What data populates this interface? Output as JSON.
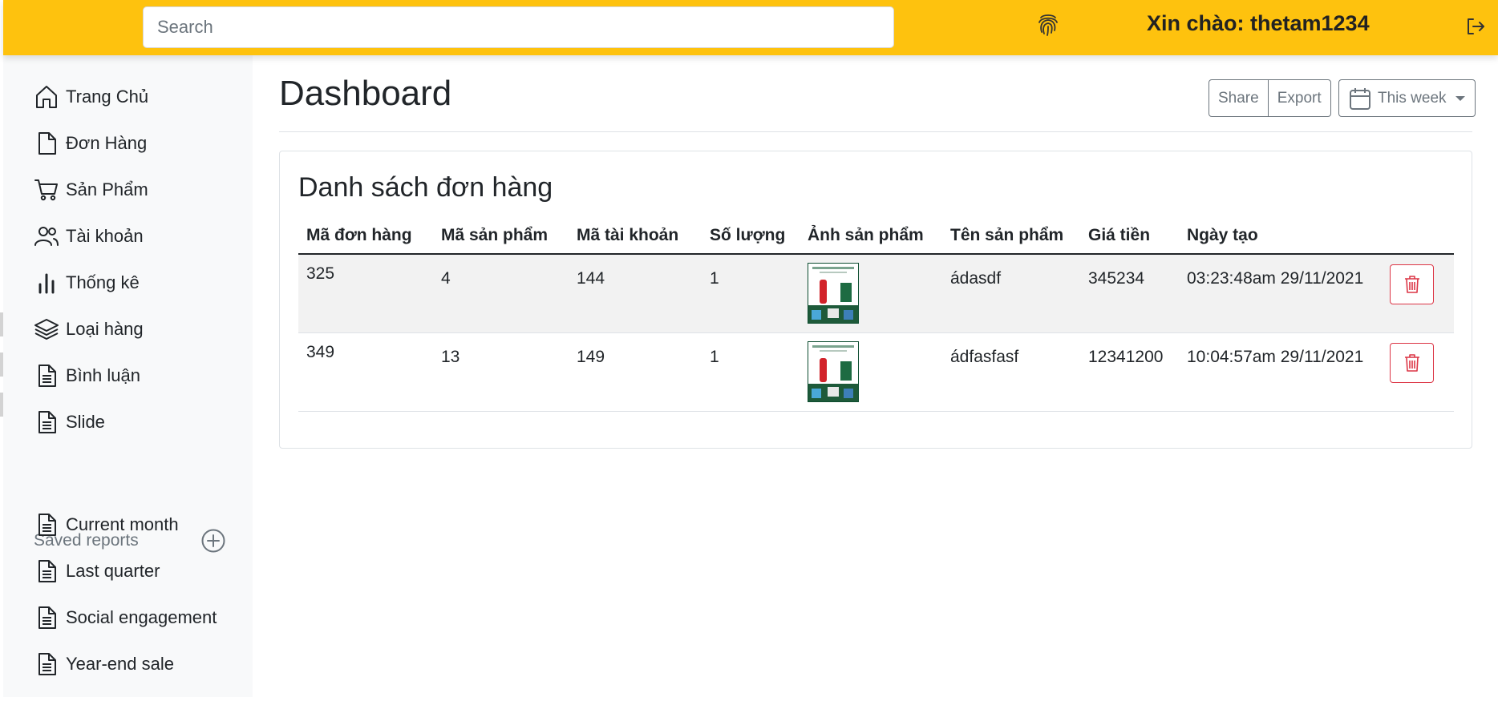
{
  "search": {
    "placeholder": "Search",
    "value": ""
  },
  "header": {
    "greeting": "Xin chào: thetam1234",
    "fingerprint_icon": "fingerprint-icon",
    "logout_icon": "logout-icon",
    "bg_color": "#fec20e"
  },
  "sidebar": {
    "items": [
      {
        "label": "Trang Chủ",
        "icon": "house-icon"
      },
      {
        "label": "Đơn Hàng",
        "icon": "file-icon"
      },
      {
        "label": "Sản Phẩm",
        "icon": "cart-icon"
      },
      {
        "label": "Tài khoản",
        "icon": "people-icon"
      },
      {
        "label": "Thống kê",
        "icon": "bar-chart-icon"
      },
      {
        "label": "Loại hàng",
        "icon": "layers-icon"
      },
      {
        "label": "Bình luận",
        "icon": "file-text-icon"
      },
      {
        "label": "Slide",
        "icon": "file-text-icon"
      }
    ],
    "saved_reports_label": "Saved reports",
    "saved_reports": [
      {
        "label": "Current month",
        "icon": "file-text-icon"
      },
      {
        "label": "Last quarter",
        "icon": "file-text-icon"
      },
      {
        "label": "Social engagement",
        "icon": "file-text-icon"
      },
      {
        "label": "Year-end sale",
        "icon": "file-text-icon"
      }
    ]
  },
  "main": {
    "title": "Dashboard",
    "share_label": "Share",
    "export_label": "Export",
    "period_label": "This week",
    "card_title": "Danh sách đơn hàng",
    "columns": [
      "Mã đơn hàng",
      "Mã sản phẩm",
      "Mã tài khoản",
      "Số lượng",
      "Ảnh sản phẩm",
      "Tên sản phẩm",
      "Giá tiền",
      "Ngày tạo"
    ],
    "rows": [
      {
        "order_id": "325",
        "product_id": "4",
        "account_id": "144",
        "quantity": "1",
        "product_name": "ádasdf",
        "price": "345234",
        "created": "03:23:48am 29/11/2021"
      },
      {
        "order_id": "349",
        "product_id": "13",
        "account_id": "149",
        "quantity": "1",
        "product_name": "ádfasfasf",
        "price": "12341200",
        "created": "10:04:57am 29/11/2021"
      }
    ]
  }
}
